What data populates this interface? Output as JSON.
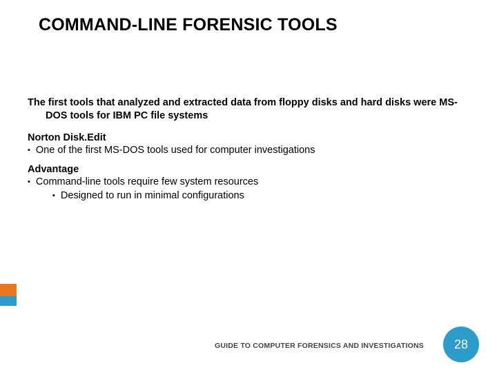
{
  "title": "COMMAND-LINE FORENSIC TOOLS",
  "intro": "The first tools that analyzed and extracted data from floppy disks and hard disks were MS-DOS tools for IBM PC file systems",
  "section1": {
    "heading": "Norton Disk.Edit",
    "bullet": "One of the first MS-DOS tools used for computer investigations"
  },
  "section2": {
    "heading": "Advantage",
    "bullet": "Command-line tools require few system resources",
    "subbullet": "Designed to run in minimal configurations"
  },
  "footer": "GUIDE TO COMPUTER FORENSICS AND INVESTIGATIONS",
  "page_number": "28",
  "colors": {
    "orange": "#E87722",
    "blue": "#2E9CCA"
  }
}
